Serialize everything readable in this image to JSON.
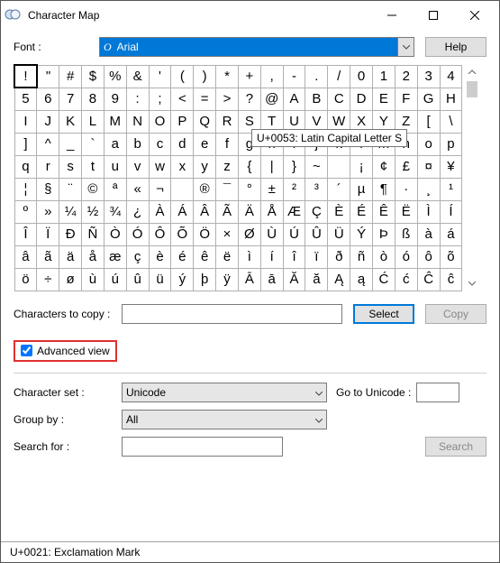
{
  "window": {
    "title": "Character Map"
  },
  "font_row": {
    "label": "Font :",
    "font_name": "Arial",
    "help": "Help"
  },
  "grid": {
    "rows": [
      [
        "!",
        "\"",
        "#",
        "$",
        "%",
        "&",
        "'",
        "(",
        ")",
        "*",
        "+",
        ",",
        "-",
        ".",
        "/",
        "0",
        "1",
        "2",
        "3",
        "4"
      ],
      [
        "5",
        "6",
        "7",
        "8",
        "9",
        ":",
        ";",
        "<",
        "=",
        ">",
        "?",
        "@",
        "A",
        "B",
        "C",
        "D",
        "E",
        "F",
        "G",
        "H"
      ],
      [
        "I",
        "J",
        "K",
        "L",
        "M",
        "N",
        "O",
        "P",
        "Q",
        "R",
        "S",
        "T",
        "U",
        "V",
        "W",
        "X",
        "Y",
        "Z",
        "[",
        "\\"
      ],
      [
        "]",
        "^",
        "_",
        "`",
        "a",
        "b",
        "c",
        "d",
        "e",
        "f",
        "g",
        "h",
        "i",
        "j",
        "k",
        "l",
        "m",
        "n",
        "o",
        "p"
      ],
      [
        "q",
        "r",
        "s",
        "t",
        "u",
        "v",
        "w",
        "x",
        "y",
        "z",
        "{",
        "|",
        "}",
        "~",
        "",
        "¡",
        "¢",
        "£",
        "¤",
        "¥"
      ],
      [
        "¦",
        "§",
        "¨",
        "©",
        "ª",
        "«",
        "¬",
        "­",
        "®",
        "¯",
        "°",
        "±",
        "²",
        "³",
        "´",
        "µ",
        "¶",
        "·",
        "¸",
        "¹"
      ],
      [
        "º",
        "»",
        "¼",
        "½",
        "¾",
        "¿",
        "À",
        "Á",
        "Â",
        "Ã",
        "Ä",
        "Å",
        "Æ",
        "Ç",
        "È",
        "É",
        "Ê",
        "Ë",
        "Ì",
        "Í"
      ],
      [
        "Î",
        "Ï",
        "Ð",
        "Ñ",
        "Ò",
        "Ó",
        "Ô",
        "Õ",
        "Ö",
        "×",
        "Ø",
        "Ù",
        "Ú",
        "Û",
        "Ü",
        "Ý",
        "Þ",
        "ß",
        "à",
        "á"
      ],
      [
        "â",
        "ã",
        "ä",
        "å",
        "æ",
        "ç",
        "è",
        "é",
        "ê",
        "ë",
        "ì",
        "í",
        "î",
        "ï",
        "ð",
        "ñ",
        "ò",
        "ó",
        "ô",
        "õ"
      ],
      [
        "ö",
        "÷",
        "ø",
        "ù",
        "ú",
        "û",
        "ü",
        "ý",
        "þ",
        "ÿ",
        "Ā",
        "ā",
        "Ă",
        "ă",
        "Ą",
        "ą",
        "Ć",
        "ć",
        "Ĉ",
        "ĉ"
      ]
    ],
    "tooltip": "U+0053: Latin Capital Letter S"
  },
  "copy_row": {
    "label": "Characters to copy :",
    "select": "Select",
    "copy": "Copy"
  },
  "adv": {
    "label": "Advanced view",
    "checked": true
  },
  "charset": {
    "label": "Character set :",
    "value": "Unicode",
    "goto_label": "Go to Unicode :"
  },
  "group": {
    "label": "Group by :",
    "value": "All"
  },
  "search": {
    "label": "Search for :",
    "button": "Search"
  },
  "status": "U+0021: Exclamation Mark"
}
